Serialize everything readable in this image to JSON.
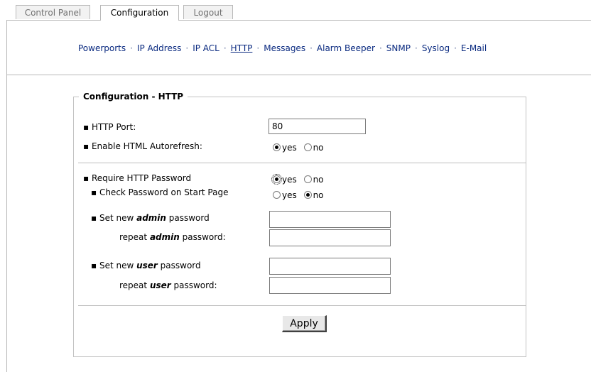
{
  "tabs": [
    {
      "label": "Control Panel",
      "active": false
    },
    {
      "label": "Configuration",
      "active": true
    },
    {
      "label": "Logout",
      "active": false
    }
  ],
  "subnav": {
    "items": [
      "Powerports",
      "IP Address",
      "IP ACL",
      "HTTP",
      "Messages",
      "Alarm Beeper",
      "SNMP",
      "Syslog",
      "E-Mail"
    ],
    "current": "HTTP",
    "separator": "·"
  },
  "section": {
    "title": "Configuration - HTTP"
  },
  "http_port": {
    "label": "▪ HTTP Port:",
    "value": "80"
  },
  "autorefresh": {
    "label": "▪ Enable HTML Autorefresh:",
    "yes_label": "yes",
    "no_label": "no",
    "selected": "yes"
  },
  "require_password": {
    "label": "▪ Require HTTP Password",
    "yes_label": "yes",
    "no_label": "no",
    "selected": "yes"
  },
  "check_password": {
    "label": "▪ Check Password on Start Page",
    "yes_label": "yes",
    "no_label": "no",
    "selected": "no"
  },
  "admin_password": {
    "label_prefix": "▪ Set new ",
    "label_emph": "admin",
    "label_suffix": " password",
    "repeat_prefix": "repeat ",
    "repeat_emph": "admin",
    "repeat_suffix": " password:",
    "value": "",
    "repeat_value": ""
  },
  "user_password": {
    "label_prefix": "▪ Set new ",
    "label_emph": "user",
    "label_suffix": " password",
    "repeat_prefix": "repeat ",
    "repeat_emph": "user",
    "repeat_suffix": " password:",
    "value": "",
    "repeat_value": ""
  },
  "apply_label": "Apply"
}
